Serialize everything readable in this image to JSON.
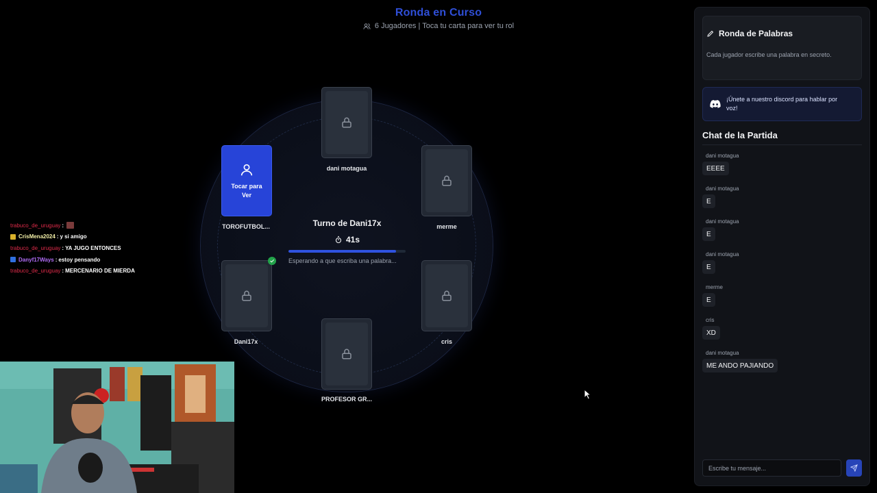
{
  "header": {
    "title": "Ronda en Curso",
    "subtitle": "6 Jugadores | Toca tu carta para ver tu rol"
  },
  "players": [
    {
      "name": "dani motagua",
      "state": "locked"
    },
    {
      "name": "TOROFUTBOL...",
      "state": "reveal",
      "reveal_label": "Tocar para Ver"
    },
    {
      "name": "merme",
      "state": "locked"
    },
    {
      "name": "Dani17x",
      "state": "locked",
      "submitted": true
    },
    {
      "name": "cris",
      "state": "locked"
    },
    {
      "name": "PROFESOR GR...",
      "state": "locked"
    }
  ],
  "turn": {
    "title": "Turno de Dani17x",
    "timer": "41s",
    "progress": 0.92,
    "status": "Esperando a que escriba una palabra..."
  },
  "stream_chat": [
    {
      "user": "trabuco_de_uruguay",
      "color": "#e02b4a",
      "badge": "",
      "text": "",
      "emote": true
    },
    {
      "user": "CrisMena2024",
      "color": "#f3f0a8",
      "badge": "#d9b12a",
      "text": "y si amigo",
      "emote": false
    },
    {
      "user": "trabuco_de_uruguay",
      "color": "#e02b4a",
      "badge": "",
      "text": "YA JUGO ENTONCES",
      "emote": false
    },
    {
      "user": "Danyf17Ways",
      "color": "#b06cf5",
      "badge": "#2f6fe0",
      "text": "estoy pensando",
      "emote": false
    },
    {
      "user": "trabuco_de_uruguay",
      "color": "#e02b4a",
      "badge": "",
      "text": "MERCENARIO DE MIERDA",
      "emote": false
    }
  ],
  "panel": {
    "round_title": "Ronda de Palabras",
    "round_desc": "Cada jugador escribe una palabra en secreto.",
    "discord_text": "¡Únete a nuestro discord para hablar por voz!",
    "chat_title": "Chat de la Partida",
    "messages": [
      {
        "author": "dani motagua",
        "text": "EEEE"
      },
      {
        "author": "dani motagua",
        "text": "E"
      },
      {
        "author": "dani motagua",
        "text": "E"
      },
      {
        "author": "dani motagua",
        "text": "E"
      },
      {
        "author": "merme",
        "text": "E"
      },
      {
        "author": "cris",
        "text": "XD"
      },
      {
        "author": "dani motagua",
        "text": "ME ANDO PAJIANDO"
      }
    ],
    "input_placeholder": "Escribe tu mensaje..."
  },
  "colors": {
    "accent": "#2f4fd8",
    "card": "#222833",
    "reveal_card": "#2744d8",
    "check": "#22a34a"
  }
}
